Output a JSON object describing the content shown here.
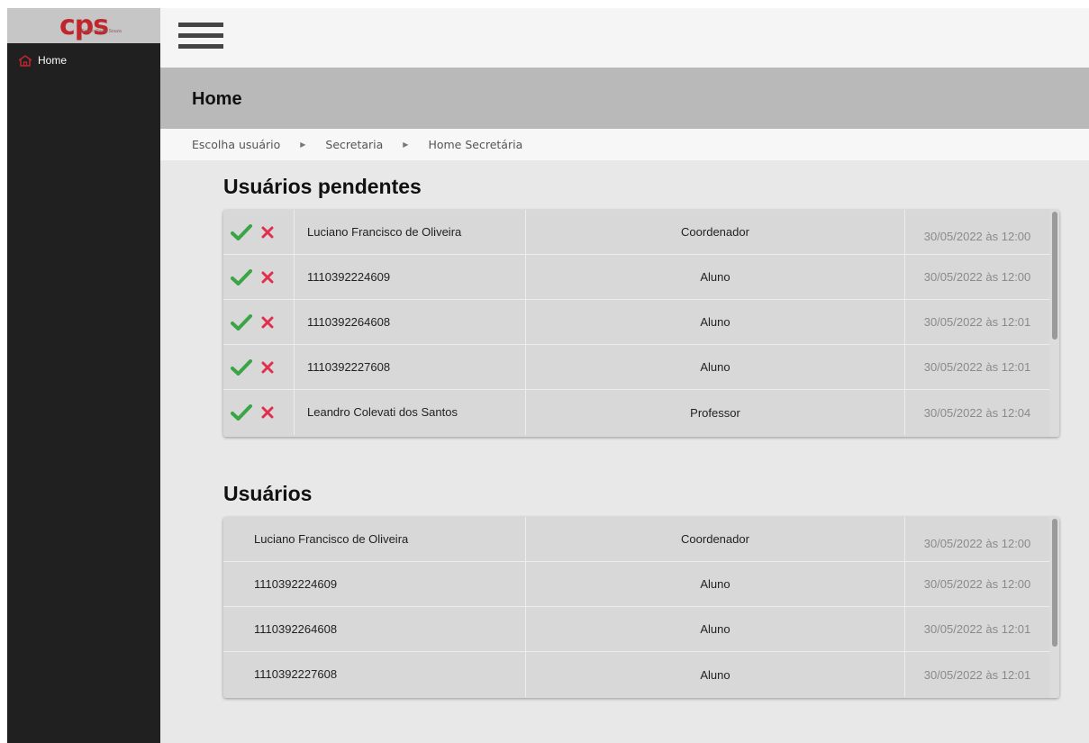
{
  "sidebar": {
    "logo": "cps",
    "logo_subtitle": "Centro Paula Souza",
    "items": [
      {
        "label": "Home",
        "icon": "home-icon"
      }
    ]
  },
  "header": {
    "title": "Home"
  },
  "breadcrumb": {
    "items": [
      "Escolha usuário",
      "Secretaria",
      "Home Secretária"
    ]
  },
  "pending": {
    "title": "Usuários pendentes",
    "rows": [
      {
        "name": "Luciano Francisco de Oliveira",
        "role": "Coordenador",
        "date": "30/05/2022 às 12:00"
      },
      {
        "name": "1110392224609",
        "role": "Aluno",
        "date": "30/05/2022 às 12:00"
      },
      {
        "name": "1110392264608",
        "role": "Aluno",
        "date": "30/05/2022 às 12:01"
      },
      {
        "name": "1110392227608",
        "role": "Aluno",
        "date": "30/05/2022 às 12:01"
      },
      {
        "name": "Leandro Colevati dos Santos",
        "role": "Professor",
        "date": "30/05/2022 às 12:04"
      }
    ]
  },
  "users": {
    "title": "Usuários",
    "rows": [
      {
        "name": "Luciano Francisco de Oliveira",
        "role": "Coordenador",
        "date": "30/05/2022 às 12:00"
      },
      {
        "name": "1110392224609",
        "role": "Aluno",
        "date": "30/05/2022 às 12:00"
      },
      {
        "name": "1110392264608",
        "role": "Aluno",
        "date": "30/05/2022 às 12:01"
      },
      {
        "name": "1110392227608",
        "role": "Aluno",
        "date": "30/05/2022 às 12:01"
      }
    ]
  },
  "colors": {
    "accent": "#c0272d",
    "approve": "#3aa545",
    "reject": "#e0304e",
    "sidebar_bg": "#202020"
  }
}
